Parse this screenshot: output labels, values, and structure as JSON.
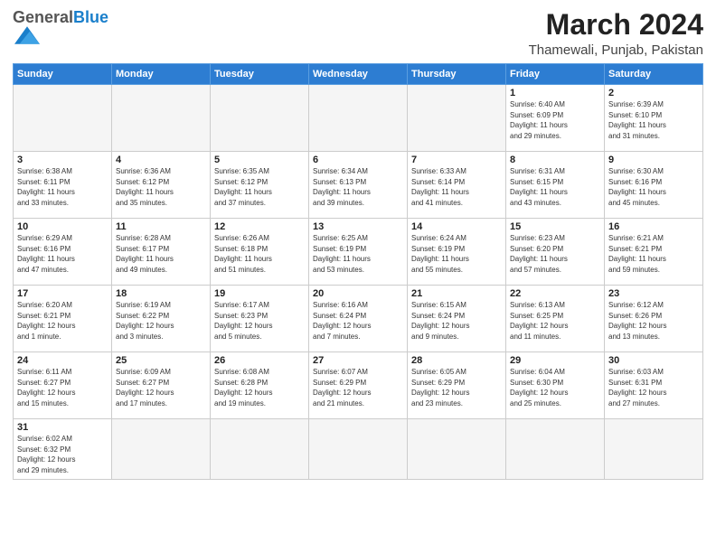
{
  "header": {
    "logo_general": "General",
    "logo_blue": "Blue",
    "month_year": "March 2024",
    "location": "Thamewali, Punjab, Pakistan"
  },
  "weekdays": [
    "Sunday",
    "Monday",
    "Tuesday",
    "Wednesday",
    "Thursday",
    "Friday",
    "Saturday"
  ],
  "weeks": [
    [
      {
        "day": "",
        "info": ""
      },
      {
        "day": "",
        "info": ""
      },
      {
        "day": "",
        "info": ""
      },
      {
        "day": "",
        "info": ""
      },
      {
        "day": "",
        "info": ""
      },
      {
        "day": "1",
        "info": "Sunrise: 6:40 AM\nSunset: 6:09 PM\nDaylight: 11 hours\nand 29 minutes."
      },
      {
        "day": "2",
        "info": "Sunrise: 6:39 AM\nSunset: 6:10 PM\nDaylight: 11 hours\nand 31 minutes."
      }
    ],
    [
      {
        "day": "3",
        "info": "Sunrise: 6:38 AM\nSunset: 6:11 PM\nDaylight: 11 hours\nand 33 minutes."
      },
      {
        "day": "4",
        "info": "Sunrise: 6:36 AM\nSunset: 6:12 PM\nDaylight: 11 hours\nand 35 minutes."
      },
      {
        "day": "5",
        "info": "Sunrise: 6:35 AM\nSunset: 6:12 PM\nDaylight: 11 hours\nand 37 minutes."
      },
      {
        "day": "6",
        "info": "Sunrise: 6:34 AM\nSunset: 6:13 PM\nDaylight: 11 hours\nand 39 minutes."
      },
      {
        "day": "7",
        "info": "Sunrise: 6:33 AM\nSunset: 6:14 PM\nDaylight: 11 hours\nand 41 minutes."
      },
      {
        "day": "8",
        "info": "Sunrise: 6:31 AM\nSunset: 6:15 PM\nDaylight: 11 hours\nand 43 minutes."
      },
      {
        "day": "9",
        "info": "Sunrise: 6:30 AM\nSunset: 6:16 PM\nDaylight: 11 hours\nand 45 minutes."
      }
    ],
    [
      {
        "day": "10",
        "info": "Sunrise: 6:29 AM\nSunset: 6:16 PM\nDaylight: 11 hours\nand 47 minutes."
      },
      {
        "day": "11",
        "info": "Sunrise: 6:28 AM\nSunset: 6:17 PM\nDaylight: 11 hours\nand 49 minutes."
      },
      {
        "day": "12",
        "info": "Sunrise: 6:26 AM\nSunset: 6:18 PM\nDaylight: 11 hours\nand 51 minutes."
      },
      {
        "day": "13",
        "info": "Sunrise: 6:25 AM\nSunset: 6:19 PM\nDaylight: 11 hours\nand 53 minutes."
      },
      {
        "day": "14",
        "info": "Sunrise: 6:24 AM\nSunset: 6:19 PM\nDaylight: 11 hours\nand 55 minutes."
      },
      {
        "day": "15",
        "info": "Sunrise: 6:23 AM\nSunset: 6:20 PM\nDaylight: 11 hours\nand 57 minutes."
      },
      {
        "day": "16",
        "info": "Sunrise: 6:21 AM\nSunset: 6:21 PM\nDaylight: 11 hours\nand 59 minutes."
      }
    ],
    [
      {
        "day": "17",
        "info": "Sunrise: 6:20 AM\nSunset: 6:21 PM\nDaylight: 12 hours\nand 1 minute."
      },
      {
        "day": "18",
        "info": "Sunrise: 6:19 AM\nSunset: 6:22 PM\nDaylight: 12 hours\nand 3 minutes."
      },
      {
        "day": "19",
        "info": "Sunrise: 6:17 AM\nSunset: 6:23 PM\nDaylight: 12 hours\nand 5 minutes."
      },
      {
        "day": "20",
        "info": "Sunrise: 6:16 AM\nSunset: 6:24 PM\nDaylight: 12 hours\nand 7 minutes."
      },
      {
        "day": "21",
        "info": "Sunrise: 6:15 AM\nSunset: 6:24 PM\nDaylight: 12 hours\nand 9 minutes."
      },
      {
        "day": "22",
        "info": "Sunrise: 6:13 AM\nSunset: 6:25 PM\nDaylight: 12 hours\nand 11 minutes."
      },
      {
        "day": "23",
        "info": "Sunrise: 6:12 AM\nSunset: 6:26 PM\nDaylight: 12 hours\nand 13 minutes."
      }
    ],
    [
      {
        "day": "24",
        "info": "Sunrise: 6:11 AM\nSunset: 6:27 PM\nDaylight: 12 hours\nand 15 minutes."
      },
      {
        "day": "25",
        "info": "Sunrise: 6:09 AM\nSunset: 6:27 PM\nDaylight: 12 hours\nand 17 minutes."
      },
      {
        "day": "26",
        "info": "Sunrise: 6:08 AM\nSunset: 6:28 PM\nDaylight: 12 hours\nand 19 minutes."
      },
      {
        "day": "27",
        "info": "Sunrise: 6:07 AM\nSunset: 6:29 PM\nDaylight: 12 hours\nand 21 minutes."
      },
      {
        "day": "28",
        "info": "Sunrise: 6:05 AM\nSunset: 6:29 PM\nDaylight: 12 hours\nand 23 minutes."
      },
      {
        "day": "29",
        "info": "Sunrise: 6:04 AM\nSunset: 6:30 PM\nDaylight: 12 hours\nand 25 minutes."
      },
      {
        "day": "30",
        "info": "Sunrise: 6:03 AM\nSunset: 6:31 PM\nDaylight: 12 hours\nand 27 minutes."
      }
    ],
    [
      {
        "day": "31",
        "info": "Sunrise: 6:02 AM\nSunset: 6:32 PM\nDaylight: 12 hours\nand 29 minutes."
      },
      {
        "day": "",
        "info": ""
      },
      {
        "day": "",
        "info": ""
      },
      {
        "day": "",
        "info": ""
      },
      {
        "day": "",
        "info": ""
      },
      {
        "day": "",
        "info": ""
      },
      {
        "day": "",
        "info": ""
      }
    ]
  ]
}
